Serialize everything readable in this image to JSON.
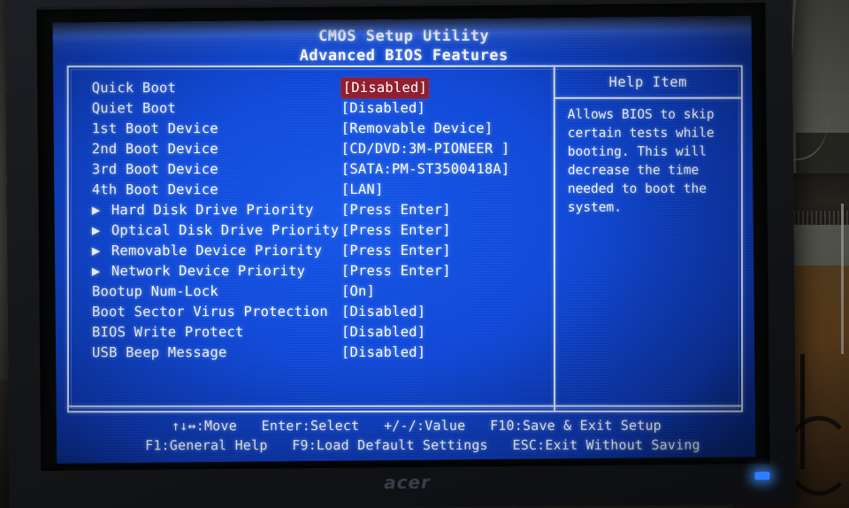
{
  "scene": {
    "device_brand": "acer"
  },
  "screen": {
    "title_line1": "CMOS Setup Utility",
    "title_line2": "Advanced BIOS Features",
    "rows": [
      {
        "arrow": "",
        "label": "Quick Boot",
        "value": "[Disabled]",
        "highlighted": true
      },
      {
        "arrow": "",
        "label": "Quiet Boot",
        "value": "[Disabled]",
        "highlighted": false
      },
      {
        "arrow": "",
        "label": "1st Boot Device",
        "value": "[Removable Device]",
        "highlighted": false
      },
      {
        "arrow": "",
        "label": "2nd Boot Device",
        "value": "[CD/DVD:3M-PIONEER ]",
        "highlighted": false
      },
      {
        "arrow": "",
        "label": "3rd Boot Device",
        "value": "[SATA:PM-ST3500418A]",
        "highlighted": false
      },
      {
        "arrow": "",
        "label": "4th Boot Device",
        "value": "[LAN]",
        "highlighted": false
      },
      {
        "arrow": "▶",
        "label": "Hard Disk Drive Priority",
        "value": "[Press Enter]",
        "highlighted": false
      },
      {
        "arrow": "▶",
        "label": "Optical Disk Drive Priority",
        "value": "[Press Enter]",
        "highlighted": false
      },
      {
        "arrow": "▶",
        "label": "Removable Device Priority",
        "value": "[Press Enter]",
        "highlighted": false
      },
      {
        "arrow": "▶",
        "label": "Network Device Priority",
        "value": "[Press Enter]",
        "highlighted": false
      },
      {
        "arrow": "",
        "label": "Bootup Num-Lock",
        "value": "[On]",
        "highlighted": false
      },
      {
        "arrow": "",
        "label": "Boot Sector Virus Protection",
        "value": "[Disabled]",
        "highlighted": false
      },
      {
        "arrow": "",
        "label": "BIOS Write Protect",
        "value": "[Disabled]",
        "highlighted": false
      },
      {
        "arrow": "",
        "label": "USB Beep Message",
        "value": "[Disabled]",
        "highlighted": false
      }
    ],
    "help": {
      "title": "Help Item",
      "text": "Allows BIOS to skip\ncertain tests while\nbooting. This will\ndecrease the time\nneeded to boot the\nsystem."
    },
    "footer": {
      "line1": "↑↓↔:Move   Enter:Select   +/-/:Value   F10:Save & Exit Setup",
      "line2": "F1:General Help   F9:Load Default Settings   ESC:Exit Without Saving"
    },
    "colors": {
      "background": "#0f46d4",
      "text": "#ffffff",
      "highlight": "#8f1d2e",
      "border": "#dfe9ff"
    }
  }
}
